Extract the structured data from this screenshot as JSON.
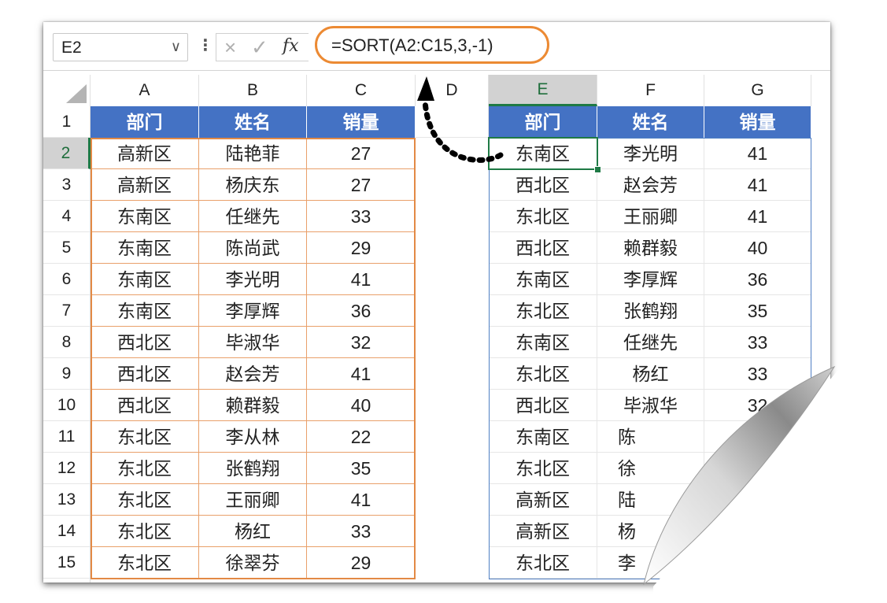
{
  "formula_bar": {
    "name_box": "E2",
    "name_box_chevron": "∨",
    "separator": "⋮",
    "cancel_icon": "×",
    "enter_icon": "✓",
    "fx": "fx",
    "formula": "=SORT(A2:C15,3,-1)"
  },
  "columns": [
    "A",
    "B",
    "C",
    "D",
    "E",
    "F",
    "G"
  ],
  "rows": [
    "1",
    "2",
    "3",
    "4",
    "5",
    "6",
    "7",
    "8",
    "9",
    "10",
    "11",
    "12",
    "13",
    "14",
    "15"
  ],
  "source_table": {
    "headers": [
      "部门",
      "姓名",
      "销量"
    ],
    "rows": [
      [
        "高新区",
        "陆艳菲",
        "27"
      ],
      [
        "高新区",
        "杨庆东",
        "27"
      ],
      [
        "东南区",
        "任继先",
        "33"
      ],
      [
        "东南区",
        "陈尚武",
        "29"
      ],
      [
        "东南区",
        "李光明",
        "41"
      ],
      [
        "东南区",
        "李厚辉",
        "36"
      ],
      [
        "西北区",
        "毕淑华",
        "32"
      ],
      [
        "西北区",
        "赵会芳",
        "41"
      ],
      [
        "西北区",
        "赖群毅",
        "40"
      ],
      [
        "东北区",
        "李从林",
        "22"
      ],
      [
        "东北区",
        "张鹤翔",
        "35"
      ],
      [
        "东北区",
        "王丽卿",
        "41"
      ],
      [
        "东北区",
        "杨红",
        "33"
      ],
      [
        "东北区",
        "徐翠芬",
        "29"
      ]
    ]
  },
  "sorted_table": {
    "headers": [
      "部门",
      "姓名",
      "销量"
    ],
    "rows": [
      [
        "东南区",
        "李光明",
        "41"
      ],
      [
        "西北区",
        "赵会芳",
        "41"
      ],
      [
        "东北区",
        "王丽卿",
        "41"
      ],
      [
        "西北区",
        "赖群毅",
        "40"
      ],
      [
        "东南区",
        "李厚辉",
        "36"
      ],
      [
        "东北区",
        "张鹤翔",
        "35"
      ],
      [
        "东南区",
        "任继先",
        "33"
      ],
      [
        "东北区",
        "杨红",
        "33"
      ],
      [
        "西北区",
        "毕淑华",
        "32"
      ],
      [
        "东南区",
        "陈",
        ""
      ],
      [
        "东北区",
        "徐",
        ""
      ],
      [
        "高新区",
        "陆",
        ""
      ],
      [
        "高新区",
        "杨",
        ""
      ],
      [
        "东北区",
        "李",
        ""
      ]
    ]
  },
  "colors": {
    "header_fill": "#4472c4",
    "source_border": "#e38a45",
    "spill_border": "#4f7fc4",
    "active_cell": "#1f7a45",
    "formula_highlight": "#ec8a33"
  },
  "icons": [
    "chevron-down-icon",
    "cancel-icon",
    "enter-icon",
    "fx-icon",
    "curved-arrow-icon",
    "page-curl-icon"
  ]
}
